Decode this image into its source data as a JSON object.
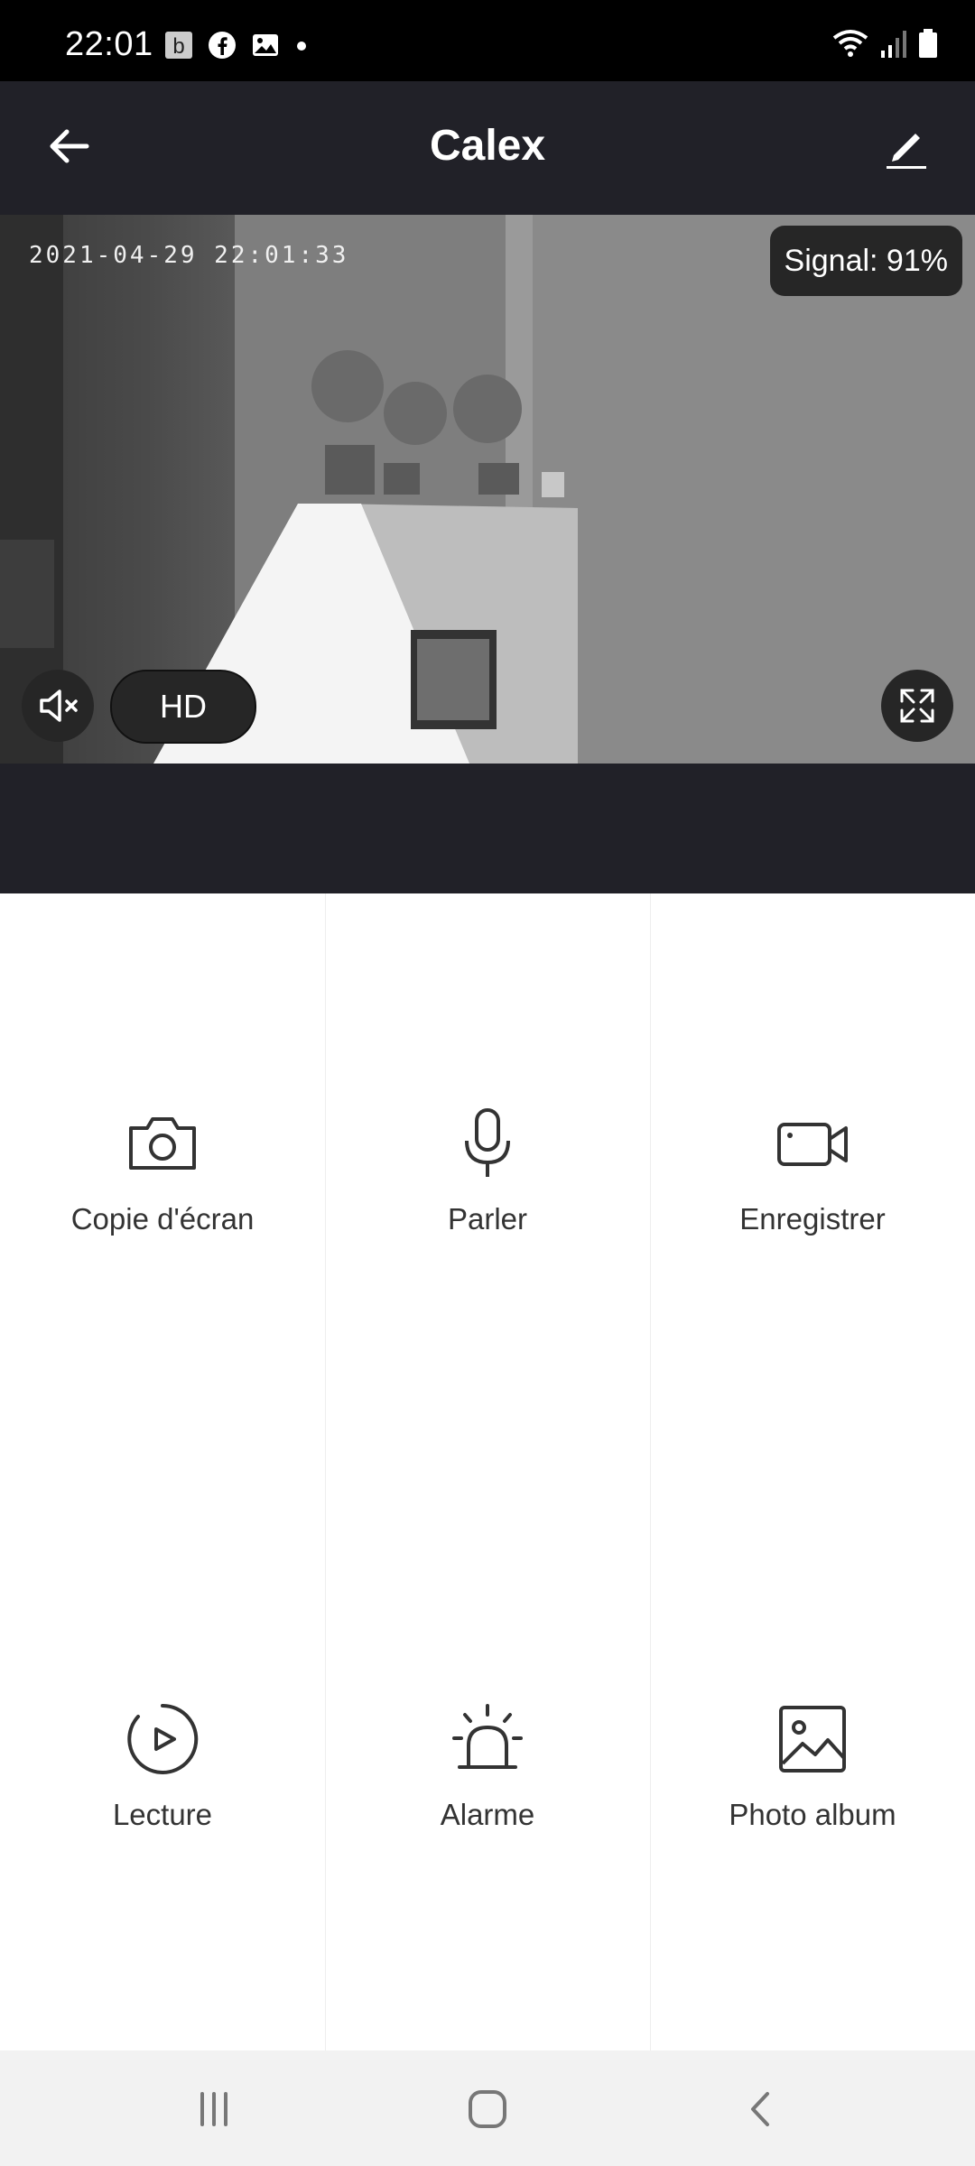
{
  "status_bar": {
    "time": "22:01",
    "notifications": [
      "b-app-icon",
      "facebook-icon",
      "gallery-icon",
      "dot-icon"
    ],
    "indicators": [
      "wifi-icon",
      "signal-bars-icon",
      "battery-icon"
    ]
  },
  "header": {
    "title": "Calex"
  },
  "video": {
    "timestamp": "2021-04-29  22:01:33",
    "signal_label": "Signal: 91%",
    "hd_label": "HD"
  },
  "actions": [
    {
      "label": "Copie d'écran",
      "icon": "camera-icon"
    },
    {
      "label": "Parler",
      "icon": "microphone-icon"
    },
    {
      "label": "Enregistrer",
      "icon": "video-camera-icon"
    },
    {
      "label": "Lecture",
      "icon": "playback-icon"
    },
    {
      "label": "Alarme",
      "icon": "alarm-siren-icon"
    },
    {
      "label": "Photo album",
      "icon": "photo-album-icon"
    }
  ],
  "nav": [
    "recent-apps-icon",
    "home-icon",
    "back-icon"
  ]
}
